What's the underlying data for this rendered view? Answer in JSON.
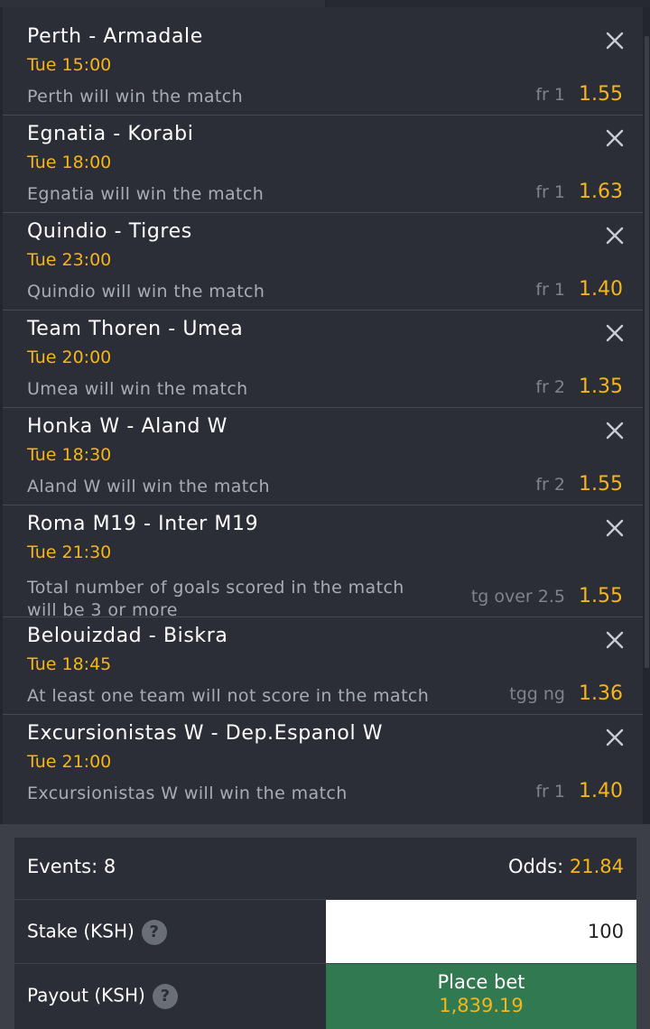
{
  "colors": {
    "background": "#2b2e37",
    "accent": "#f5b51b",
    "place_bet": "#317a51",
    "muted_text": "#a8acb5"
  },
  "bets": [
    {
      "match": "Perth - Armadale",
      "time": "Tue 15:00",
      "pick": "Perth will win the match",
      "market": "fr 1",
      "odd": "1.55"
    },
    {
      "match": "Egnatia - Korabi",
      "time": "Tue 18:00",
      "pick": "Egnatia will win the match",
      "market": "fr 1",
      "odd": "1.63"
    },
    {
      "match": "Quindio - Tigres",
      "time": "Tue 23:00",
      "pick": "Quindio will win the match",
      "market": "fr 1",
      "odd": "1.40"
    },
    {
      "match": "Team Thoren - Umea",
      "time": "Tue 20:00",
      "pick": "Umea will win the match",
      "market": "fr 2",
      "odd": "1.35"
    },
    {
      "match": "Honka W - Aland W",
      "time": "Tue 18:30",
      "pick": "Aland W will win the match",
      "market": "fr 2",
      "odd": "1.55"
    },
    {
      "match": "Roma M19 - Inter M19",
      "time": "Tue 21:30",
      "pick": "Total number of goals scored in the match will be 3 or more",
      "market": "tg over 2.5",
      "odd": "1.55"
    },
    {
      "match": "Belouizdad - Biskra",
      "time": "Tue 18:45",
      "pick": "At least one team will not score in the match",
      "market": "tgg ng",
      "odd": "1.36"
    },
    {
      "match": "Excursionistas W - Dep.Espanol W",
      "time": "Tue 21:00",
      "pick": "Excursionistas W will win the match",
      "market": "fr 1",
      "odd": "1.40"
    }
  ],
  "summary": {
    "events_label": "Events: 8",
    "odds_label": "Odds:",
    "odds_value": "21.84"
  },
  "stake": {
    "label": "Stake (KSH)",
    "help": "?",
    "value": "100"
  },
  "payout": {
    "label": "Payout (KSH)",
    "help": "?",
    "button_label": "Place bet",
    "amount": "1,839.19"
  },
  "icons": {
    "remove": "close-icon",
    "help": "help-icon"
  }
}
